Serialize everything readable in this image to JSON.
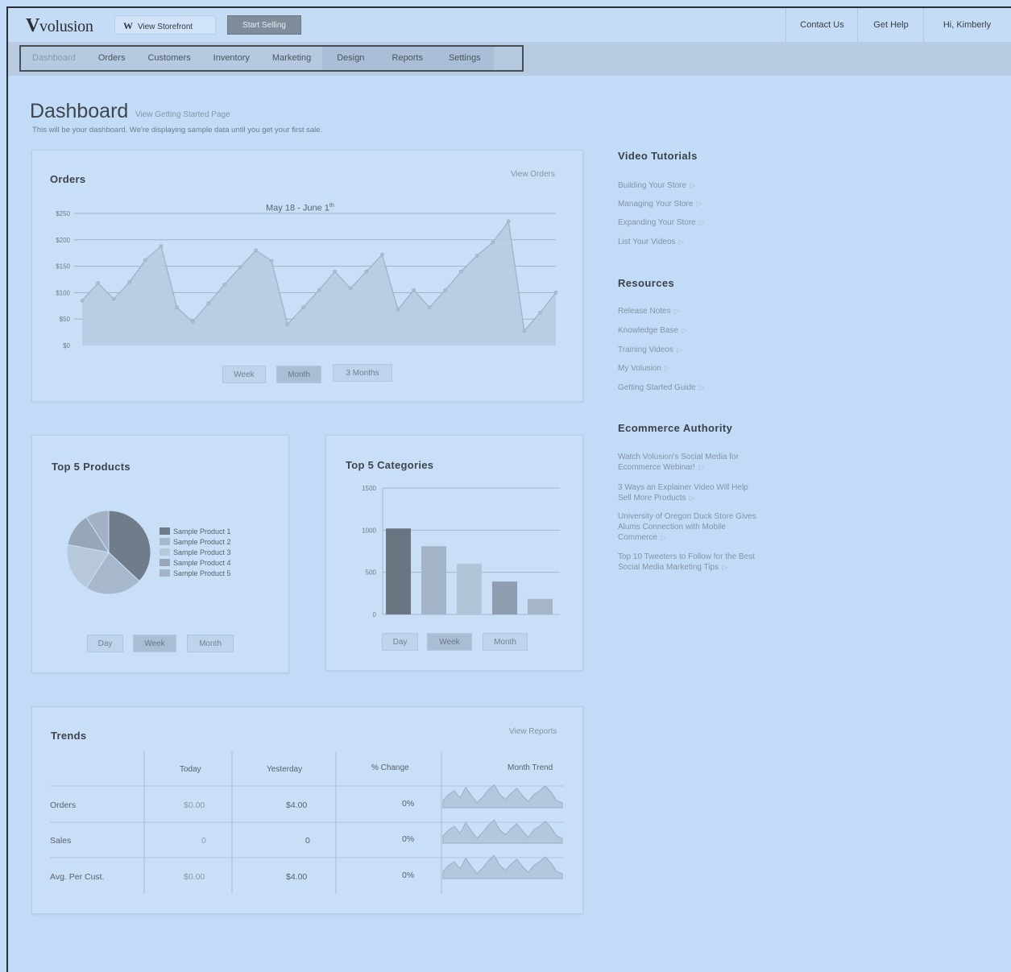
{
  "header": {
    "logo": "volusion",
    "view_store": "View Storefront",
    "start_selling": "Start Selling",
    "links": [
      "Contact Us",
      "Get Help",
      "Hi, Kimberly"
    ]
  },
  "nav": {
    "items": [
      "Dashboard",
      "Orders",
      "Customers",
      "Inventory",
      "Marketing",
      "Design",
      "Reports",
      "Settings"
    ],
    "active": "Dashboard"
  },
  "page": {
    "title": "Dashboard",
    "title_link": "View Getting Started Page",
    "intro": "This will be your dashboard. We're displaying sample data until you get your first sale."
  },
  "orders_card": {
    "title": "Orders",
    "link": "View Orders",
    "range_label": "May 18 - June 1",
    "range_sup": "th",
    "buttons": [
      "Week",
      "Month",
      "3 Months"
    ],
    "selected_button": "Month"
  },
  "chart_data": [
    {
      "type": "area",
      "title": "Orders",
      "subtitle": "May 18 - June 1th",
      "y_tick_labels": [
        "$0",
        "$50",
        "$100",
        "$150",
        "$200",
        "$250"
      ],
      "ylim": [
        0,
        250
      ],
      "values": [
        85,
        118,
        88,
        120,
        162,
        188,
        72,
        45,
        80,
        115,
        148,
        180,
        160,
        40,
        72,
        105,
        140,
        108,
        140,
        172,
        68,
        105,
        72,
        105,
        140,
        170,
        195,
        235,
        28,
        62,
        100
      ],
      "grid": true
    },
    {
      "type": "pie",
      "title": "Top 5 Products",
      "labels": [
        "Sample Product 1",
        "Sample Product 2",
        "Sample Product 3",
        "Sample Product 4",
        "Sample Product 5"
      ],
      "values": [
        37,
        22,
        19,
        13,
        9
      ],
      "colors": [
        "#707c89",
        "#a7b8cc",
        "#b7c8da",
        "#97a7b9",
        "#a3b2c4"
      ]
    },
    {
      "type": "bar",
      "title": "Top 5 Categories",
      "categories": [
        "1",
        "2",
        "3",
        "4",
        "5"
      ],
      "values": [
        1020,
        810,
        600,
        390,
        185
      ],
      "y_tick_labels": [
        "0",
        "500",
        "1000",
        "1500"
      ],
      "ylim": [
        0,
        1500
      ],
      "colors": [
        "#6a7581",
        "#a3b4c8",
        "#b2c4d7",
        "#8e9db0",
        "#a6b6c9"
      ]
    }
  ],
  "products_card": {
    "title": "Top 5 Products",
    "buttons": [
      "Day",
      "Week",
      "Month"
    ],
    "selected_button": "Week"
  },
  "categories_card": {
    "title": "Top 5 Categories",
    "buttons": [
      "Day",
      "Week",
      "Month"
    ],
    "selected_button": "Week"
  },
  "trends": {
    "title": "Trends",
    "link": "View Reports",
    "columns": [
      "Today",
      "Yesterday",
      "% Change",
      "Month Trend"
    ],
    "rows": [
      {
        "label": "Orders",
        "today": "$0.00",
        "yesterday": "$4.00",
        "change": "0%"
      },
      {
        "label": "Sales",
        "today": "0",
        "yesterday": "0",
        "change": "0%"
      },
      {
        "label": "Avg. Per Cust.",
        "today": "$0.00",
        "yesterday": "$4.00",
        "change": "0%"
      }
    ]
  },
  "sidebar": {
    "video": {
      "heading": "Video Tutorials",
      "links": [
        "Building Your Store",
        "Managing Your Store",
        "Expanding Your Store",
        "List Your Videos"
      ]
    },
    "resources": {
      "heading": "Resources",
      "links": [
        "Release Notes",
        "Knowledge Base",
        "Training Videos",
        "My Volusion",
        "Getting Started Guide"
      ]
    },
    "authority": {
      "heading": "Ecommerce Authority",
      "links": [
        "Watch Volusion's Social Media for Ecommerce Webinar!",
        "3 Ways an Explainer Video Will Help Sell More Products",
        "University of Oregon Duck Store Gives Alums Connection with Mobile Commerce",
        "Top 10 Tweeters to Follow for the Best Social Media Marketing Tips"
      ]
    }
  },
  "colors": {
    "background": "#c2dcf7",
    "card": "#c8dff7",
    "start_selling": "#7f8c99",
    "chart_line": "#9eb0c5"
  }
}
